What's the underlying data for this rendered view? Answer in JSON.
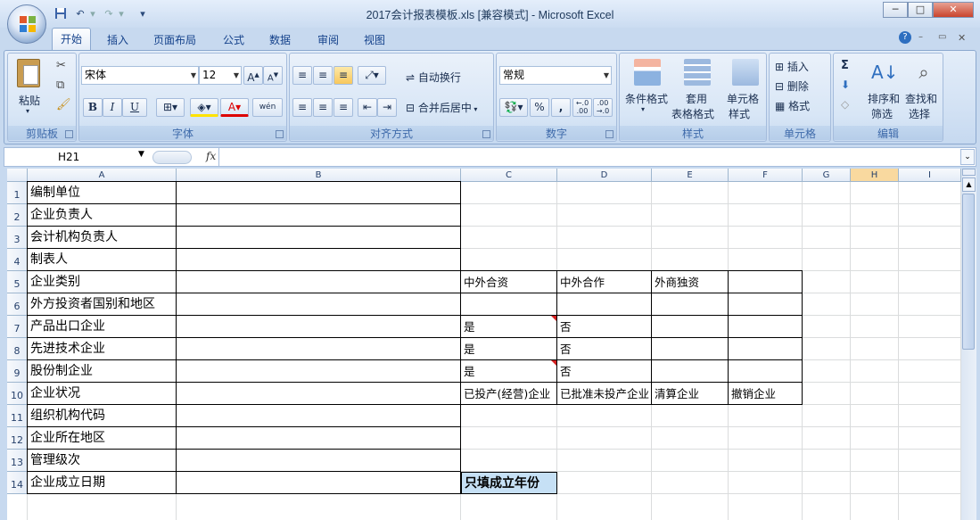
{
  "window": {
    "title": "2017会计报表模板.xls  [兼容模式] - Microsoft Excel",
    "min_label": "─",
    "max_label": "□",
    "close_label": "✕"
  },
  "quick_access": {
    "save_icon": "save-icon",
    "undo_icon": "undo-icon",
    "redo_icon": "redo-icon",
    "customize": "▾"
  },
  "tabs": [
    "开始",
    "插入",
    "页面布局",
    "公式",
    "数据",
    "审阅",
    "视图"
  ],
  "ribbon": {
    "clipboard": {
      "paste": "粘贴",
      "label": "剪贴板"
    },
    "font": {
      "name": "宋体",
      "size": "12",
      "bold": "B",
      "italic": "I",
      "underline": "U",
      "label": "字体",
      "wen": "wén"
    },
    "alignment": {
      "wrap": "自动换行",
      "merge": "合并后居中",
      "label": "对齐方式"
    },
    "number": {
      "format": "常规",
      "percent": "%",
      "comma": ",",
      "inc_decimal": ".0 .00",
      "label": "数字"
    },
    "styles": {
      "cond_format": "条件格式",
      "table_format_1": "套用",
      "table_format_2": "表格格式",
      "cell_style_1": "单元格",
      "cell_style_2": "样式",
      "label": "样式"
    },
    "cells": {
      "insert": "插入",
      "delete": "删除",
      "format": "格式",
      "label": "单元格"
    },
    "editing": {
      "sum": "Σ",
      "sort_1": "排序和",
      "sort_2": "筛选",
      "find_1": "查找和",
      "find_2": "选择",
      "label": "编辑"
    }
  },
  "formula_bar": {
    "name_box": "H21",
    "fx": "fx",
    "formula": ""
  },
  "columns": [
    "A",
    "B",
    "C",
    "D",
    "E",
    "F",
    "G",
    "H",
    "I"
  ],
  "selected_column": "H",
  "rows": [
    {
      "n": "1",
      "a": "编制单位",
      "c": "",
      "d": "",
      "e": "",
      "f": ""
    },
    {
      "n": "2",
      "a": "企业负责人",
      "c": "",
      "d": "",
      "e": "",
      "f": ""
    },
    {
      "n": "3",
      "a": "会计机构负责人",
      "c": "",
      "d": "",
      "e": "",
      "f": ""
    },
    {
      "n": "4",
      "a": "制表人",
      "c": "",
      "d": "",
      "e": "",
      "f": ""
    },
    {
      "n": "5",
      "a": "企业类别",
      "c": "中外合资",
      "d": "中外合作",
      "e": "外商独资",
      "f": ""
    },
    {
      "n": "6",
      "a": "外方投资者国别和地区",
      "c": "",
      "d": "",
      "e": "",
      "f": ""
    },
    {
      "n": "7",
      "a": "产品出口企业",
      "c": "是",
      "d": "否",
      "e": "",
      "f": ""
    },
    {
      "n": "8",
      "a": "先进技术企业",
      "c": "是",
      "d": "否",
      "e": "",
      "f": ""
    },
    {
      "n": "9",
      "a": "股份制企业",
      "c": "是",
      "d": "否",
      "e": "",
      "f": ""
    },
    {
      "n": "10",
      "a": "企业状况",
      "c": "已投产(经营)企业",
      "d": "已批准未投产企业",
      "e": "清算企业",
      "f": "撤销企业"
    },
    {
      "n": "11",
      "a": "组织机构代码",
      "c": "",
      "d": "",
      "e": "",
      "f": ""
    },
    {
      "n": "12",
      "a": "企业所在地区",
      "c": "",
      "d": "",
      "e": "",
      "f": ""
    },
    {
      "n": "13",
      "a": "管理级次",
      "c": "",
      "d": "",
      "e": "",
      "f": ""
    },
    {
      "n": "14",
      "a": "企业成立日期",
      "c": "只填成立年份",
      "d": "",
      "e": "",
      "f": ""
    }
  ],
  "colors": {
    "selected_header": "#f9d99f",
    "note_cell": "#c6e0f5",
    "comment_marker": "#d42020"
  }
}
